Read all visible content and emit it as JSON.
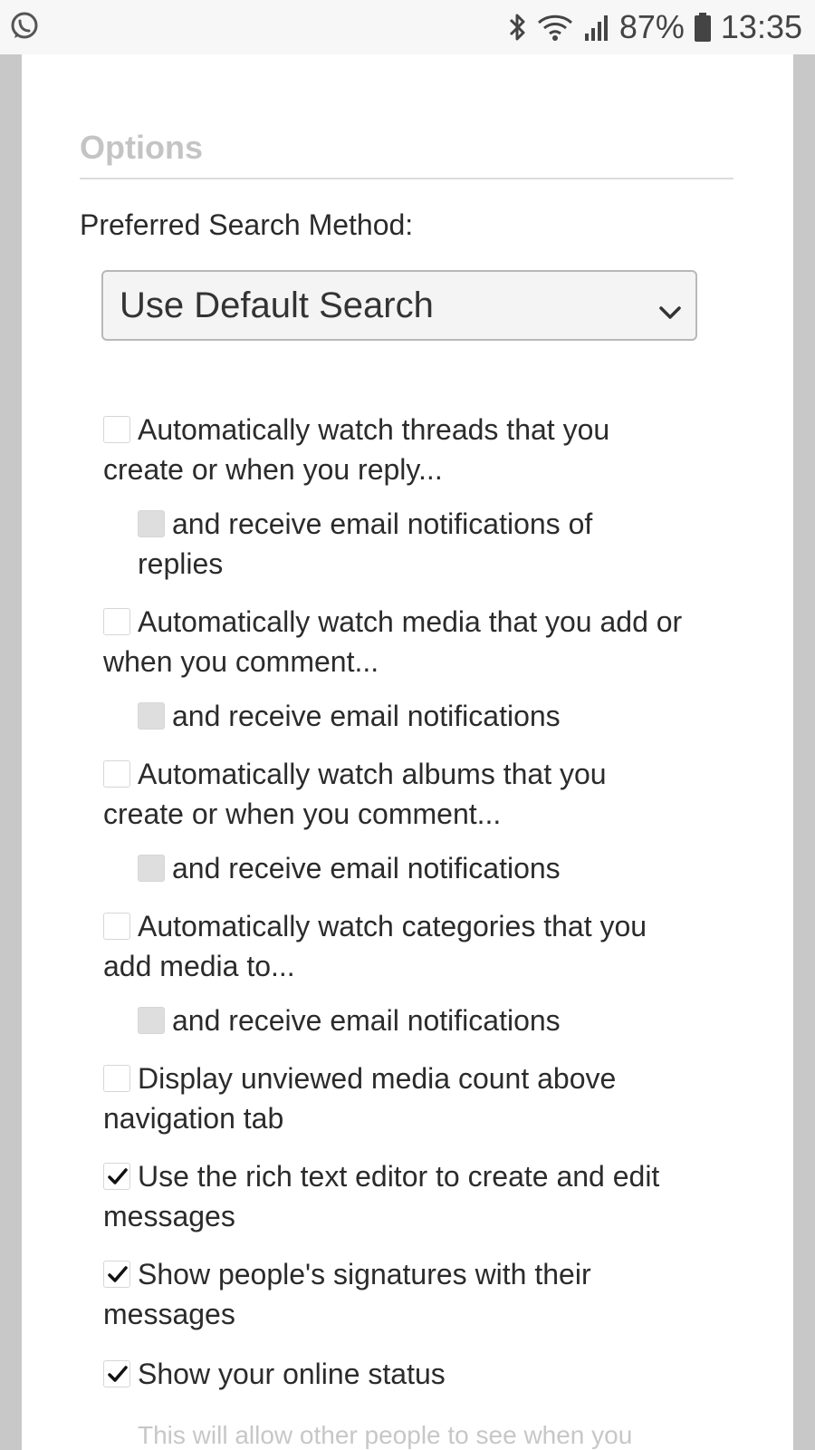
{
  "status_bar": {
    "battery": "87%",
    "time": "13:35",
    "icons": [
      "whatsapp-icon",
      "bluetooth-icon",
      "wifi-icon",
      "signal-icon",
      "battery-icon"
    ]
  },
  "options": {
    "heading": "Options",
    "search_label": "Preferred Search Method:",
    "search_select": {
      "value": "Use Default Search"
    },
    "items": [
      {
        "label": "Automatically watch threads that you create or when you reply...",
        "checked": false
      },
      {
        "label": "and receive email notifications of replies",
        "checked": false,
        "disabled": true
      },
      {
        "label": "Automatically watch media that you add or when you comment...",
        "checked": false
      },
      {
        "label": "and receive email notifications",
        "checked": false,
        "disabled": true
      },
      {
        "label": "Automatically watch albums that you create or when you comment...",
        "checked": false
      },
      {
        "label": "and receive email notifications",
        "checked": false,
        "disabled": true
      },
      {
        "label": "Automatically watch categories that you add media to...",
        "checked": false
      },
      {
        "label": "and receive email notifications",
        "checked": false,
        "disabled": true
      },
      {
        "label": "Display unviewed media count above navigation tab",
        "checked": false
      },
      {
        "label": "Use the rich text editor to create and edit messages",
        "checked": true
      },
      {
        "label": "Show people's signatures with their messages",
        "checked": true
      },
      {
        "label": "Show your online status",
        "checked": true
      }
    ],
    "online_status_note": "This will allow other people to see when you"
  },
  "colors": {
    "heading": "#c4c4c4",
    "page_bg": "#c8c8c8",
    "disabled_checkbox": "#dedede"
  }
}
